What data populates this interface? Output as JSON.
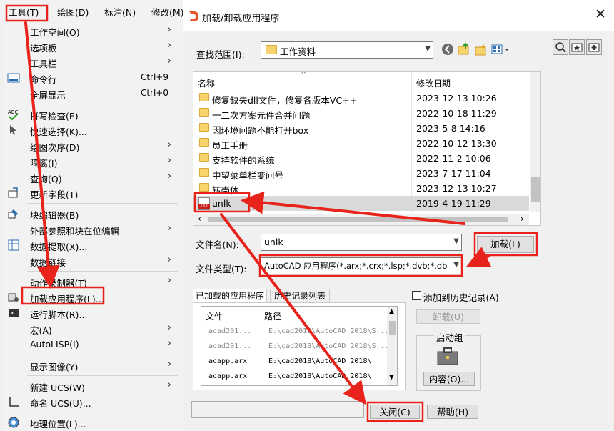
{
  "menubar": {
    "items": [
      "工具(T)",
      "绘图(D)",
      "标注(N)",
      "修改(M)"
    ]
  },
  "tools_menu": {
    "items": [
      {
        "label": "工作空间(O)",
        "submenu": true
      },
      {
        "label": "选项板",
        "submenu": true
      },
      {
        "label": "工具栏",
        "submenu": true
      },
      {
        "label": "命令行",
        "shortcut": "Ctrl+9",
        "icon": "command-line-icon"
      },
      {
        "label": "全屏显示",
        "shortcut": "Ctrl+0"
      },
      {
        "label": "拼写检查(E)",
        "icon": "spell-check-icon"
      },
      {
        "label": "快速选择(K)...",
        "icon": "quick-select-icon"
      },
      {
        "label": "绘图次序(D)",
        "submenu": true
      },
      {
        "label": "隔离(I)",
        "submenu": true
      },
      {
        "label": "查询(Q)",
        "submenu": true
      },
      {
        "label": "更新字段(T)",
        "icon": "update-field-icon"
      },
      {
        "label": "块编辑器(B)",
        "icon": "block-editor-icon"
      },
      {
        "label": "外部参照和块在位编辑",
        "submenu": true
      },
      {
        "label": "数据提取(X)...",
        "icon": "data-extract-icon"
      },
      {
        "label": "数据链接",
        "submenu": true
      },
      {
        "label": "动作录制器(T)",
        "submenu": true
      },
      {
        "label": "加载应用程序(L)...",
        "icon": "load-app-icon"
      },
      {
        "label": "运行脚本(R)...",
        "icon": "run-script-icon"
      },
      {
        "label": "宏(A)",
        "submenu": true
      },
      {
        "label": "AutoLISP(I)",
        "submenu": true
      },
      {
        "label": "显示图像(Y)",
        "submenu": true
      },
      {
        "label": "新建 UCS(W)",
        "submenu": true
      },
      {
        "label": "命名 UCS(U)...",
        "icon": "named-ucs-icon"
      },
      {
        "label": "地理位置(L)...",
        "icon": "geo-location-icon"
      }
    ]
  },
  "dialog": {
    "title": "加载/卸载应用程序",
    "look_in_label": "查找范围(I):",
    "look_in_value": "工作资料",
    "columns": {
      "name": "名称",
      "date": "修改日期"
    },
    "files": [
      {
        "name": "修复缺失dll文件，修复各版本VC++",
        "date": "2023-12-13 10:26"
      },
      {
        "name": "一二次方案元件合并问题",
        "date": "2022-10-18 11:29"
      },
      {
        "name": "因环境问题不能打开box",
        "date": "2023-5-8 14:16"
      },
      {
        "name": "员工手册",
        "date": "2022-10-12 13:30"
      },
      {
        "name": "支持软件的系统",
        "date": "2022-11-2 10:06"
      },
      {
        "name": "中望菜单栏变问号",
        "date": "2023-7-17 11:04"
      },
      {
        "name": "转壳体",
        "date": "2023-12-13 10:27"
      },
      {
        "name": "unlk",
        "date": "2019-4-19 11:29",
        "type": "lsp"
      }
    ],
    "lsp_badge": "LSP",
    "filename_label": "文件名(N):",
    "filename_value": "unlk",
    "filetype_label": "文件类型(T):",
    "filetype_value": "AutoCAD 应用程序(*.arx;*.crx;*.lsp;*.dvb;*.dbx",
    "load_button": "加载(L)",
    "tabs": [
      "已加载的应用程序",
      "历史记录列表"
    ],
    "loaded_columns": {
      "file": "文件",
      "path": "路径"
    },
    "loaded_apps": [
      {
        "file": "acad201...",
        "path": "E:\\cad2018\\AutoCAD 2018\\S..."
      },
      {
        "file": "acad201...",
        "path": "E:\\cad2018\\AutoCAD 2018\\S..."
      },
      {
        "file": "acapp.arx",
        "path": "E:\\cad2018\\AutoCAD 2018\\"
      },
      {
        "file": "acapp.arx",
        "path": "E:\\cad2018\\AutoCAD 2018\\"
      }
    ],
    "add_to_history_label": "添加到历史记录(A)",
    "unload_button": "卸载(U)",
    "startup_suite_label": "启动组",
    "contents_button": "内容(O)...",
    "close_button": "关闭(C)",
    "help_button": "帮助(H)"
  },
  "colors": {
    "annotation": "#e8231b",
    "selected_row": "#d9d9d9",
    "folder": "#f7d36b"
  }
}
